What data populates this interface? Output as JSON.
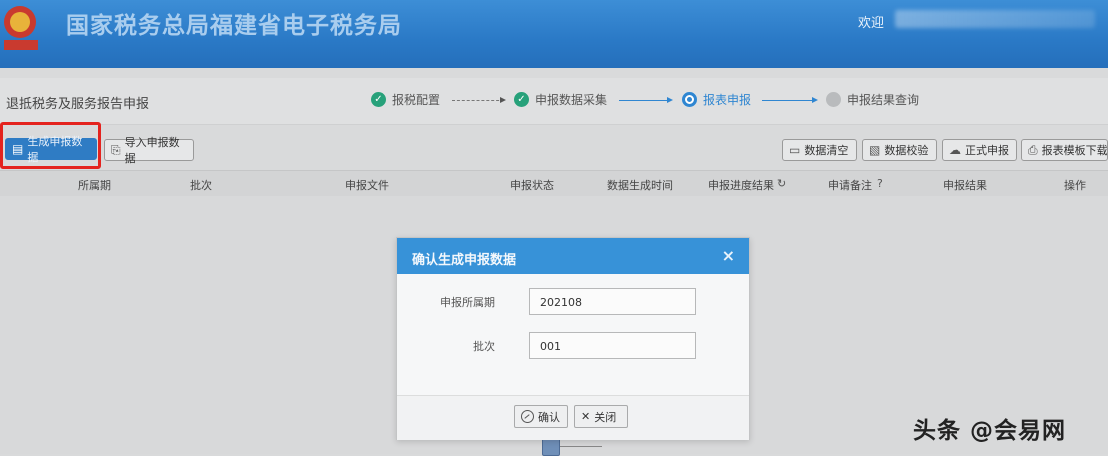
{
  "header": {
    "title": "国家税务总局福建省电子税务局",
    "welcome": "欢迎"
  },
  "page": {
    "heading": "退抵税务及服务报告申报"
  },
  "steps": [
    {
      "label": "报税配置",
      "status": "done"
    },
    {
      "label": "申报数据采集",
      "status": "done"
    },
    {
      "label": "报表申报",
      "status": "current"
    },
    {
      "label": "申报结果查询",
      "status": "todo"
    }
  ],
  "toolbar": {
    "generate": "生成申报数据",
    "import": "导入申报数据",
    "clear": "数据清空",
    "check": "数据校验",
    "submit": "正式申报",
    "download": "报表模板下载"
  },
  "table": {
    "columns": [
      "所属期",
      "批次",
      "申报文件",
      "申报状态",
      "数据生成时间",
      "申报进度结果",
      "申请备注",
      "申报结果",
      "操作"
    ]
  },
  "dialog": {
    "title": "确认生成申报数据",
    "close_glyph": "×",
    "period_label": "申报所属期",
    "period_value": "202108",
    "batch_label": "批次",
    "batch_value": "001",
    "ok_label": "确认",
    "close_label": "关闭"
  },
  "watermark": "头条 @会易网",
  "colors": {
    "header": "#2a79c6",
    "primary": "#2f7cc4",
    "done": "#27a17a",
    "dialog_head": "#3792d8",
    "highlight": "#e4231e"
  }
}
